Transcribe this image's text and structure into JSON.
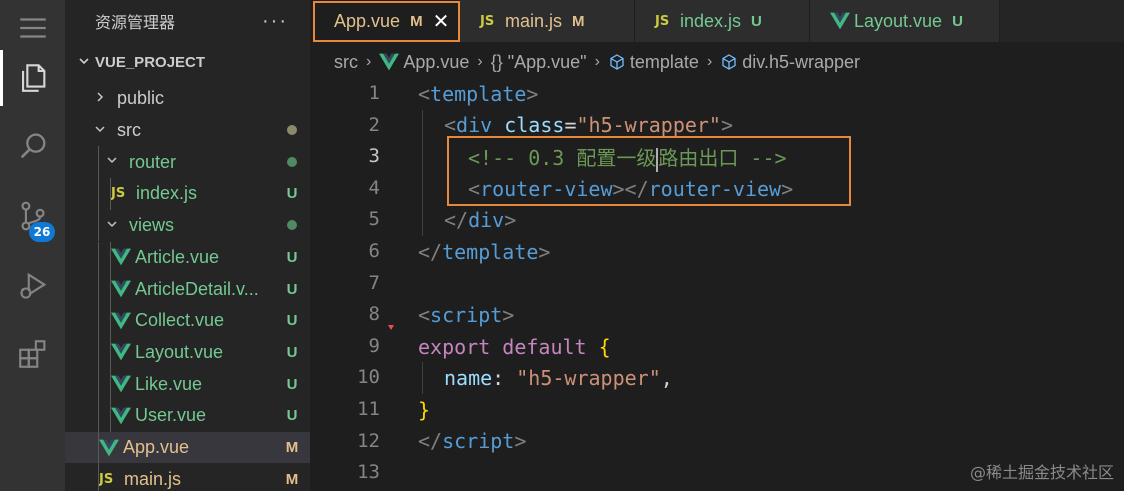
{
  "activity_bar": {
    "items": [
      {
        "icon": "hamburger-menu-icon"
      },
      {
        "icon": "explorer-files-icon"
      },
      {
        "icon": "search-icon"
      },
      {
        "icon": "source-control-icon",
        "badge": "26"
      },
      {
        "icon": "run-debug-icon"
      },
      {
        "icon": "extensions-icon"
      }
    ],
    "badge_color": "#0e7ad3"
  },
  "sidebar": {
    "title": "资源管理器",
    "more": "···",
    "section": "VUE_PROJECT",
    "tree": [
      {
        "label": "public",
        "type": "folder",
        "expanded": false,
        "depth": 1,
        "status": "",
        "color": "#cccccc"
      },
      {
        "label": "src",
        "type": "folder",
        "expanded": true,
        "depth": 1,
        "status": "dot",
        "color": "#cccccc"
      },
      {
        "label": "router",
        "type": "folder",
        "expanded": true,
        "depth": 2,
        "status": "dot",
        "color": "#73c991"
      },
      {
        "label": "index.js",
        "type": "js",
        "depth": 3,
        "status": "U",
        "color": "#73c991"
      },
      {
        "label": "views",
        "type": "folder",
        "expanded": true,
        "depth": 2,
        "status": "dot",
        "color": "#73c991"
      },
      {
        "label": "Article.vue",
        "type": "vue",
        "depth": 3,
        "status": "U",
        "color": "#73c991"
      },
      {
        "label": "ArticleDetail.v...",
        "type": "vue",
        "depth": 3,
        "status": "U",
        "color": "#73c991"
      },
      {
        "label": "Collect.vue",
        "type": "vue",
        "depth": 3,
        "status": "U",
        "color": "#73c991"
      },
      {
        "label": "Layout.vue",
        "type": "vue",
        "depth": 3,
        "status": "U",
        "color": "#73c991"
      },
      {
        "label": "Like.vue",
        "type": "vue",
        "depth": 3,
        "status": "U",
        "color": "#73c991"
      },
      {
        "label": "User.vue",
        "type": "vue",
        "depth": 3,
        "status": "U",
        "color": "#73c991"
      },
      {
        "label": "App.vue",
        "type": "vue",
        "depth": 2,
        "status": "M",
        "color": "#e2c08d",
        "selected": true
      },
      {
        "label": "main.js",
        "type": "js",
        "depth": 2,
        "status": "M",
        "color": "#e2c08d"
      }
    ]
  },
  "tabs": [
    {
      "label": "App.vue",
      "type": "vue",
      "status": "M",
      "active": true,
      "close": "✕",
      "color": "#e2c08d"
    },
    {
      "label": "main.js",
      "type": "js",
      "status": "M",
      "active": false,
      "color": "#e2c08d"
    },
    {
      "label": "index.js",
      "type": "js",
      "status": "U",
      "active": false,
      "color": "#73c991"
    },
    {
      "label": "Layout.vue",
      "type": "vue",
      "status": "U",
      "active": false,
      "color": "#73c991"
    }
  ],
  "breadcrumb": {
    "items": [
      "src",
      "App.vue",
      "{} \"App.vue\"",
      "template",
      "div.h5-wrapper"
    ]
  },
  "editor": {
    "current_line": 3,
    "line_numbers": [
      "1",
      "2",
      "3",
      "4",
      "5",
      "6",
      "7",
      "8",
      "9",
      "10",
      "11",
      "12",
      "13"
    ],
    "lines": {
      "l1": {
        "open": "<",
        "tag": "template",
        "close": ">"
      },
      "l2": {
        "open": "<",
        "tag": "div",
        "attr": "class",
        "eq": "=",
        "val": "\"h5-wrapper\"",
        "close": ">"
      },
      "l3": {
        "comment_a": "<!-- 0.3 配置一级",
        "comment_b": "路由出口 -->"
      },
      "l4": {
        "open": "<",
        "tag": "router-view",
        "mid": "></",
        "tag2": "router-view",
        "close": ">"
      },
      "l5": {
        "open": "</",
        "tag": "div",
        "close": ">"
      },
      "l6": {
        "open": "</",
        "tag": "template",
        "close": ">"
      },
      "l8": {
        "open": "<",
        "tag": "script",
        "close": ">"
      },
      "l9": {
        "kw": "export",
        "kw2": "default",
        "brace": "{"
      },
      "l10": {
        "prop": "name",
        "colon": ":",
        "val": "\"h5-wrapper\"",
        "comma": ","
      },
      "l11": {
        "brace": "}"
      },
      "l12": {
        "open": "</",
        "tag": "script",
        "close": ">"
      }
    }
  },
  "watermark": "@稀土掘金技术社区",
  "colors": {
    "modified": "#e2c08d",
    "untracked": "#73c991",
    "highlight": "#e8883a",
    "vue_green": "#41b883",
    "js_yellow": "#cbcb41"
  }
}
